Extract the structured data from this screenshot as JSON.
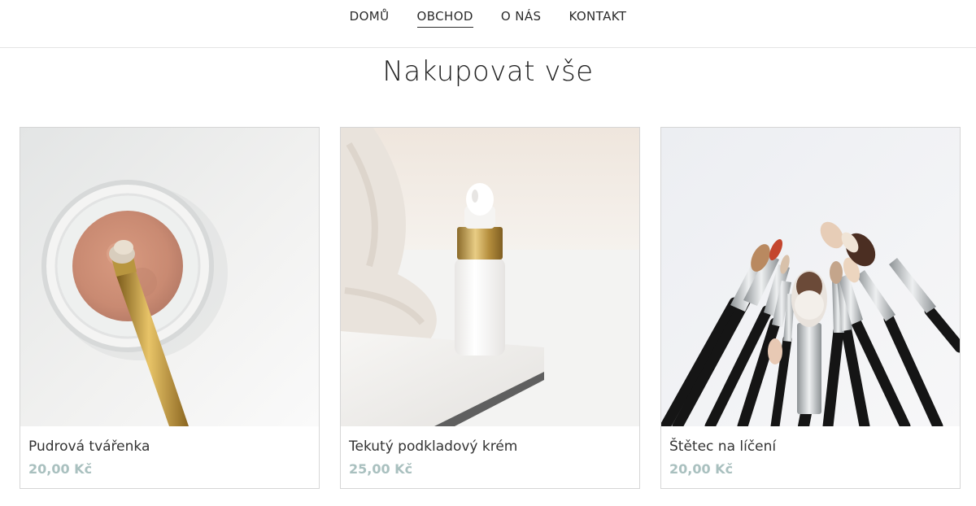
{
  "nav": {
    "items": [
      {
        "label": "DOMŮ"
      },
      {
        "label": "OBCHOD"
      },
      {
        "label": "O NÁS"
      },
      {
        "label": "KONTAKT"
      }
    ]
  },
  "page": {
    "title": "Nakupovat vše"
  },
  "products": [
    {
      "name": "Pudrová tvářenka",
      "price": "20,00 Kč"
    },
    {
      "name": "Tekutý podkladový krém",
      "price": "25,00 Kč"
    },
    {
      "name": "Štětec na líčení",
      "price": "20,00 Kč"
    }
  ],
  "colors": {
    "price": "#a9c0bf",
    "border": "#d6d6d6",
    "text": "#2b2b2b"
  }
}
